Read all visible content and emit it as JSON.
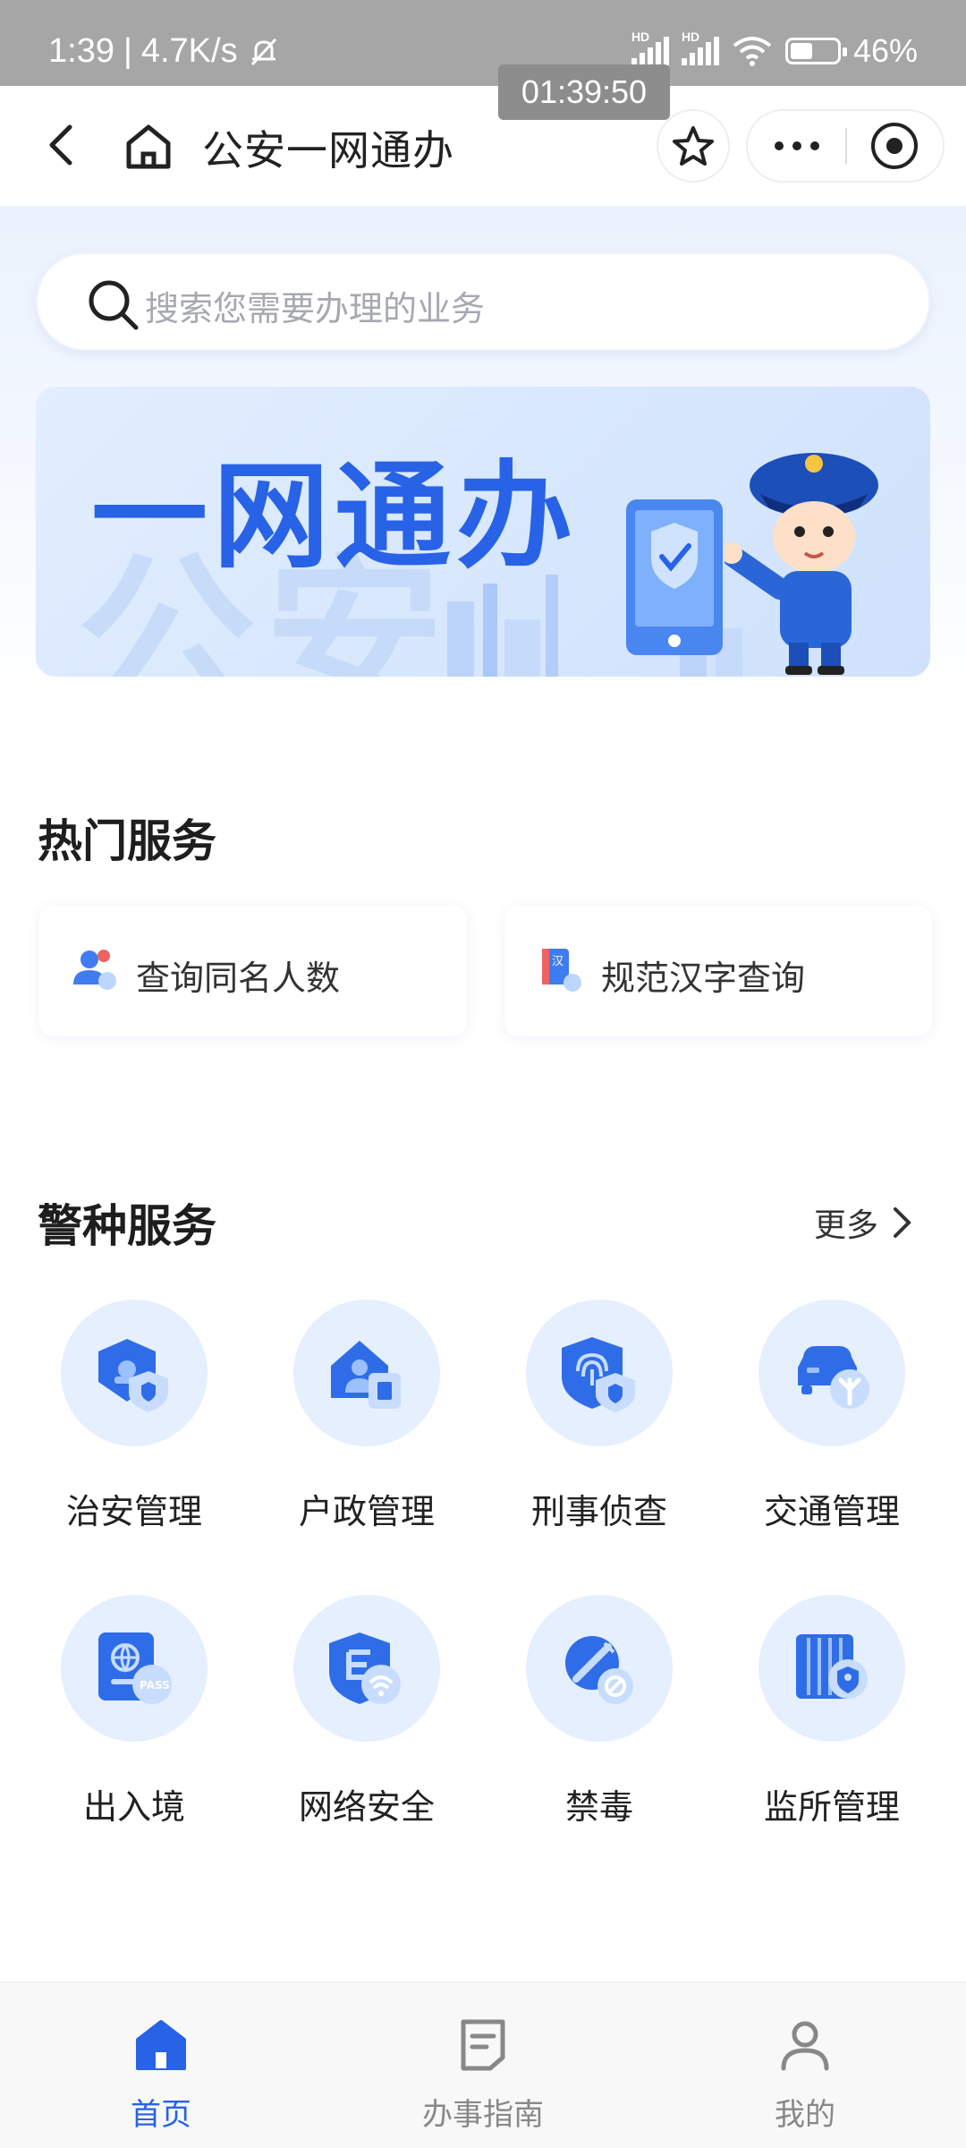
{
  "status_bar": {
    "time": "1:39",
    "speed": "4.7K/s",
    "battery": "46%",
    "timer_overlay": "01:39:50"
  },
  "header": {
    "title": "公安一网通办"
  },
  "search": {
    "placeholder": "搜索您需要办理的业务"
  },
  "banner": {
    "title": "一网通办",
    "background_text": "公安",
    "badge_text": "公安"
  },
  "hot_services": {
    "title": "热门服务",
    "items": [
      {
        "label": "查询同名人数",
        "icon": "user-search-icon"
      },
      {
        "label": "规范汉字查询",
        "icon": "chinese-character-book-icon"
      }
    ]
  },
  "police_services": {
    "title": "警种服务",
    "more_label": "更多",
    "items": [
      {
        "label": "治安管理",
        "icon": "public-security-shield-icon"
      },
      {
        "label": "户政管理",
        "icon": "household-registration-icon"
      },
      {
        "label": "刑事侦查",
        "icon": "fingerprint-shield-icon"
      },
      {
        "label": "交通管理",
        "icon": "traffic-car-icon"
      },
      {
        "label": "出入境",
        "icon": "passport-icon"
      },
      {
        "label": "网络安全",
        "icon": "cyber-security-icon"
      },
      {
        "label": "禁毒",
        "icon": "anti-drug-icon"
      },
      {
        "label": "监所管理",
        "icon": "prison-management-icon"
      }
    ]
  },
  "bottom_nav": {
    "items": [
      {
        "label": "首页",
        "icon": "home-icon",
        "active": true
      },
      {
        "label": "办事指南",
        "icon": "guide-document-icon",
        "active": false
      },
      {
        "label": "我的",
        "icon": "profile-icon",
        "active": false
      }
    ]
  },
  "colors": {
    "accent": "#2862e6",
    "icon_circle": "#e5effd",
    "status_bar": "#a6a6a6"
  }
}
